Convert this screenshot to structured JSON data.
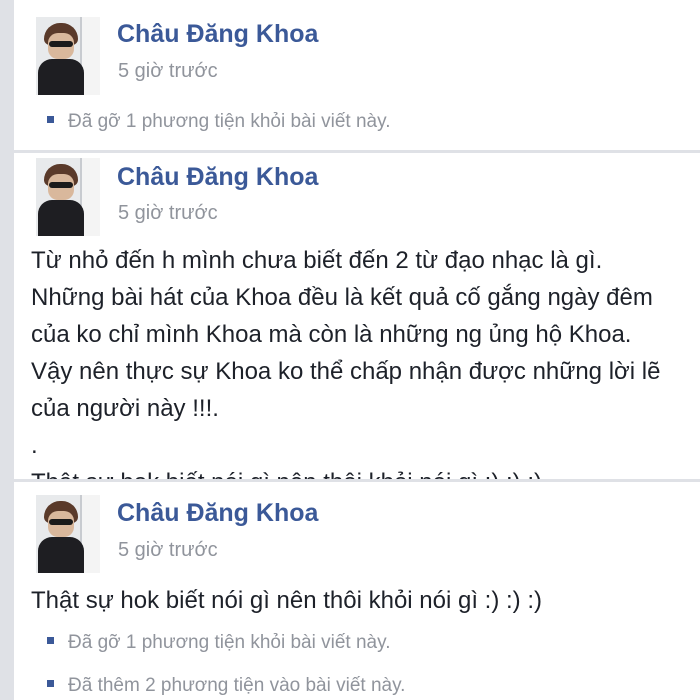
{
  "posts": [
    {
      "author": "Châu Đăng Khoa",
      "time": "5 giờ trước",
      "notes": [
        "Đã gỡ 1 phương tiện khỏi bài viết này."
      ]
    },
    {
      "author": "Châu Đăng Khoa",
      "time": "5 giờ trước",
      "text": "Từ nhỏ đến h mình chưa biết đến 2 từ đạo nhạc là gì.\nNhững bài hát của Khoa đều là kết quả cố gắng ngày đêm của ko chỉ mình Khoa mà còn là những ng ủng hộ Khoa. Vậy nên thực sự Khoa ko thể chấp nhận được những lời lẽ của người này !!!.\n.\nThật sự hok biết nói gì nên thôi khỏi nói gì :) :) :)"
    },
    {
      "author": "Châu Đăng Khoa",
      "time": "5 giờ trước",
      "text": "Thật sự hok biết nói gì nên thôi khỏi nói gì :) :) :)",
      "notes": [
        "Đã gỡ 1 phương tiện khỏi bài viết này.",
        "Đã thêm 2 phương tiện vào bài viết này."
      ]
    }
  ],
  "colors": {
    "author_link": "#3b5998",
    "meta_text": "#90949c",
    "body_text": "#1d2129",
    "feed_bg": "#dfe1e6"
  }
}
